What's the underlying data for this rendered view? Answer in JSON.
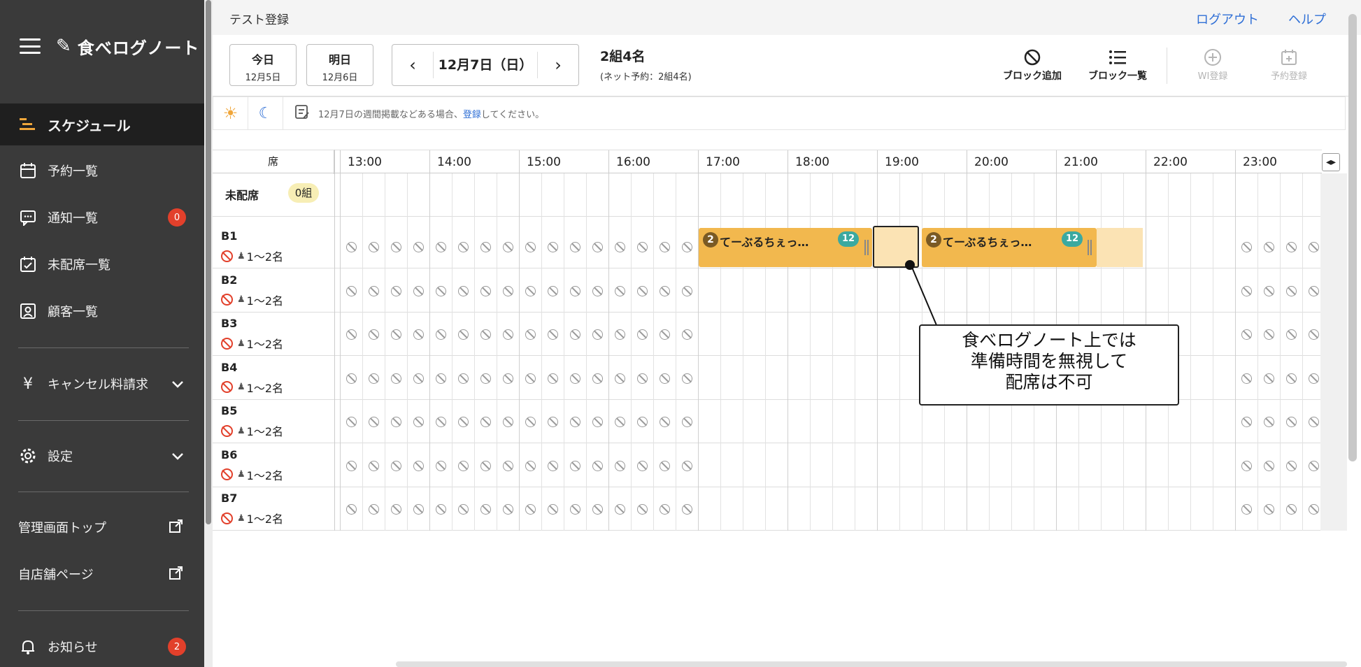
{
  "sidebar": {
    "logo": "食べログノート",
    "items": [
      {
        "label": "スケジュール",
        "icon": "schedule-icon"
      },
      {
        "label": "予約一覧",
        "icon": "calendar-icon"
      },
      {
        "label": "通知一覧",
        "icon": "message-icon",
        "badge": "0"
      },
      {
        "label": "未配席一覧",
        "icon": "calendar-check-icon"
      },
      {
        "label": "顧客一覧",
        "icon": "customer-icon"
      },
      {
        "label": "キャンセル料請求",
        "icon": "yen-icon"
      },
      {
        "label": "設定",
        "icon": "gear-icon"
      },
      {
        "label": "管理画面トップ",
        "icon": "external-link-icon"
      },
      {
        "label": "自店舗ページ",
        "icon": "external-link-icon"
      },
      {
        "label": "お知らせ",
        "icon": "bell-icon",
        "badge": "2"
      }
    ]
  },
  "topbar": {
    "page_name": "テスト登録",
    "logout": "ログアウト",
    "help": "ヘルプ"
  },
  "datebar": {
    "today_label": "今日",
    "today_date": "12月5日",
    "tomorrow_label": "明日",
    "tomorrow_date": "12月6日",
    "current_date": "12月7日（日）",
    "summary": "2組4名",
    "net_summary": "(ネット予約：2組4名)",
    "tools": [
      "ブロック追加",
      "ブロック一覧",
      "WI登録",
      "予約登録"
    ]
  },
  "memo": {
    "text_before": "12月7日の週間掲載などある場合、",
    "text_link": "登録",
    "text_after": "してください。"
  },
  "grid": {
    "seat_header": "席",
    "hours": [
      "13:00",
      "14:00",
      "15:00",
      "16:00",
      "17:00",
      "18:00",
      "19:00",
      "20:00",
      "21:00",
      "22:00",
      "23:00"
    ],
    "unseated_label": "未配席",
    "unseated_count": "0組",
    "seats": [
      {
        "name": "B1",
        "capacity": "1〜2名"
      },
      {
        "name": "B2",
        "capacity": "1〜2名"
      },
      {
        "name": "B3",
        "capacity": "1〜2名"
      },
      {
        "name": "B4",
        "capacity": "1〜2名"
      },
      {
        "name": "B5",
        "capacity": "1〜2名"
      },
      {
        "name": "B6",
        "capacity": "1〜2名"
      },
      {
        "name": "B7",
        "capacity": "1〜2名"
      }
    ],
    "reservations": [
      {
        "people": "2",
        "name": "てーぶるちぇっ…",
        "table": "12"
      },
      {
        "people": "2",
        "name": "てーぶるちぇっ…",
        "table": "12"
      }
    ]
  },
  "callout": {
    "line1": "食べログノート上では",
    "line2": "準備時間を無視して",
    "line3": "配席は不可"
  }
}
